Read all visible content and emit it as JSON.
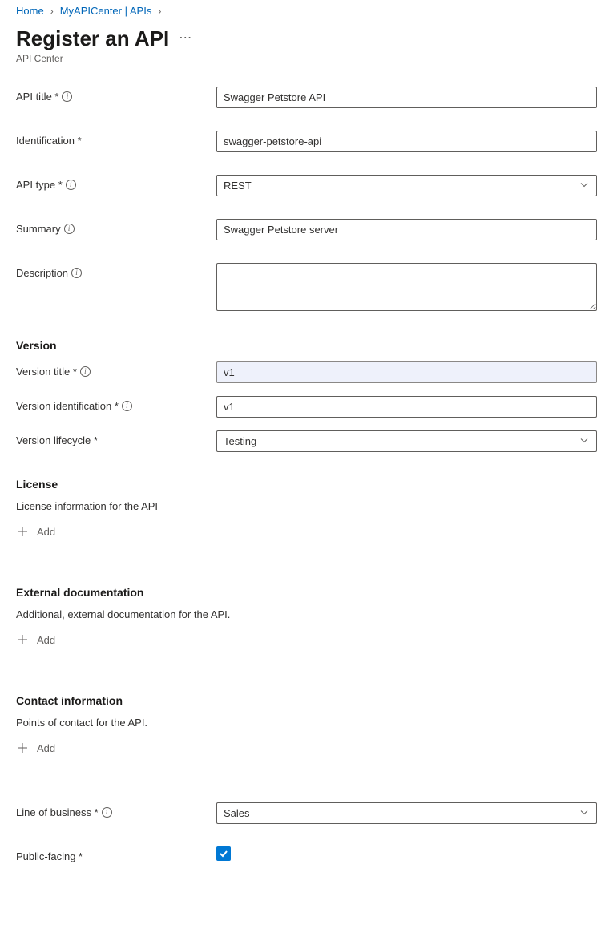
{
  "breadcrumb": {
    "home": "Home",
    "center": "MyAPICenter | APIs"
  },
  "header": {
    "title": "Register an API",
    "subtitle": "API Center"
  },
  "form": {
    "api_title_label": "API title *",
    "api_title_value": "Swagger Petstore API",
    "identification_label": "Identification *",
    "identification_value": "swagger-petstore-api",
    "api_type_label": "API type *",
    "api_type_value": "REST",
    "summary_label": "Summary",
    "summary_value": "Swagger Petstore server",
    "description_label": "Description",
    "description_value": ""
  },
  "version": {
    "heading": "Version",
    "title_label": "Version title *",
    "title_value": "v1",
    "id_label": "Version identification *",
    "id_value": "v1",
    "lifecycle_label": "Version lifecycle *",
    "lifecycle_value": "Testing"
  },
  "license": {
    "heading": "License",
    "desc": "License information for the API",
    "add": "Add"
  },
  "external": {
    "heading": "External documentation",
    "desc": "Additional, external documentation for the API.",
    "add": "Add"
  },
  "contact": {
    "heading": "Contact information",
    "desc": "Points of contact for the API.",
    "add": "Add"
  },
  "lob": {
    "label": "Line of business *",
    "value": "Sales"
  },
  "public": {
    "label": "Public-facing *",
    "checked": true
  }
}
